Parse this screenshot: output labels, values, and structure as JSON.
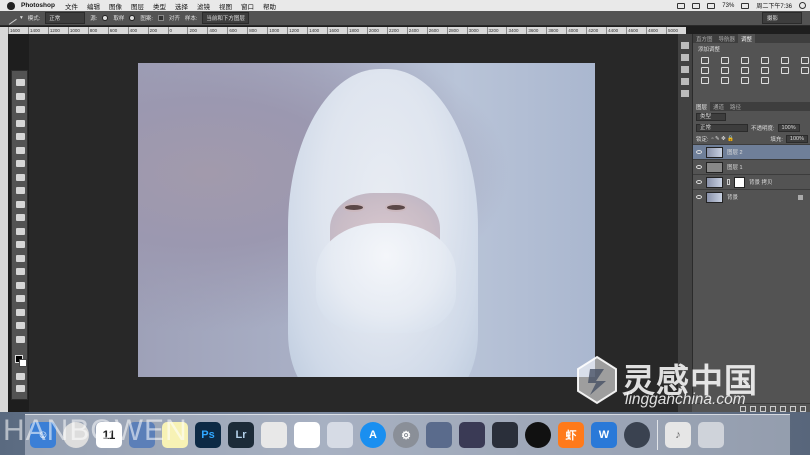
{
  "menubar": {
    "app_name": "Photoshop",
    "menus": [
      "文件",
      "编辑",
      "图像",
      "图层",
      "类型",
      "选择",
      "滤镜",
      "视图",
      "窗口",
      "帮助"
    ],
    "battery": "73%",
    "clock": "周二下午7:36"
  },
  "options": {
    "mode_label": "模式:",
    "mode_value": "正常",
    "source_label": "源:",
    "sampled_label": "取样",
    "pattern_label": "图案:",
    "aligned_label": "对齐",
    "sample_label": "样本:",
    "sample_value": "当前和下方图层",
    "workspace": "摄影"
  },
  "ruler_ticks": [
    "1600",
    "1400",
    "1200",
    "1000",
    "800",
    "600",
    "400",
    "200",
    "0",
    "200",
    "400",
    "600",
    "800",
    "1000",
    "1200",
    "1400",
    "1600",
    "1800",
    "2000",
    "2200",
    "2400",
    "2600",
    "2800",
    "3000",
    "3200",
    "3400",
    "3600",
    "3800",
    "4000",
    "4200",
    "4400",
    "4600",
    "4800",
    "5000"
  ],
  "panels": {
    "top_tabs": [
      "直方图",
      "导航器",
      "调整"
    ],
    "active_top_tab": "调整",
    "adjust_title": "添加调整",
    "layer_tabs": [
      "图层",
      "通道",
      "路径"
    ],
    "kind_filter": "类型",
    "blend_mode": "正常",
    "opacity_label": "不透明度:",
    "opacity": "100%",
    "lock_label": "锁定:",
    "fill_label": "填充:",
    "fill": "100%",
    "layers": [
      {
        "name": "图层 2",
        "selected": true
      },
      {
        "name": "图层 1",
        "selected": false
      },
      {
        "name": "背景 拷贝",
        "selected": false
      },
      {
        "name": "背景",
        "selected": false
      }
    ]
  },
  "watermarks": {
    "cn": "灵感中国",
    "en": "lingganchina.com",
    "huaban": "HANBOWEN"
  },
  "dock": {
    "calendar_day": "11",
    "ps": "Ps",
    "lr": "Lr",
    "xiami": "虾",
    "w": "W"
  }
}
